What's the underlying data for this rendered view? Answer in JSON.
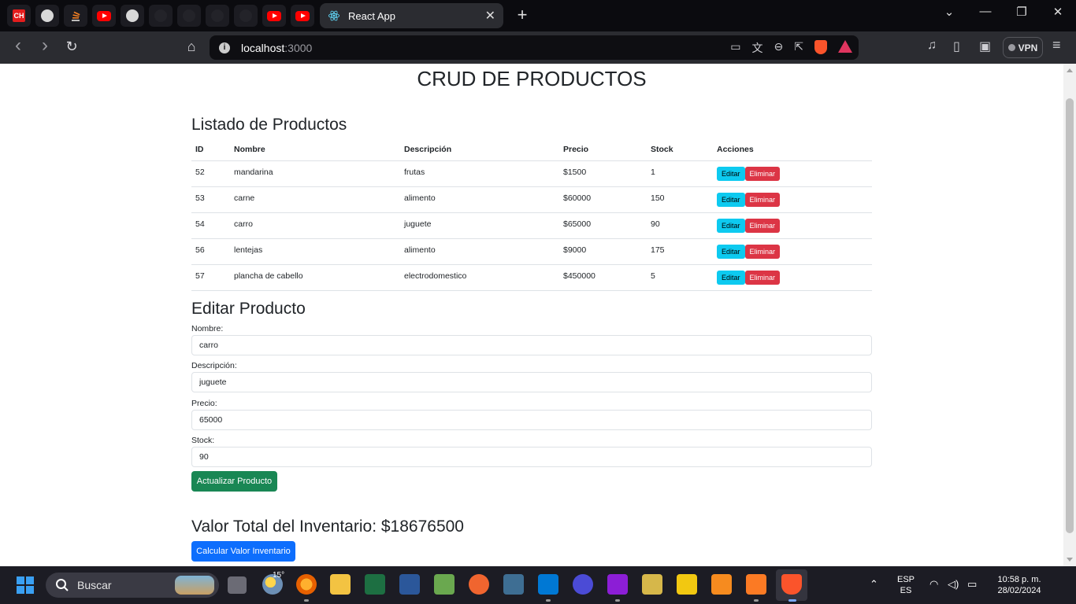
{
  "browser": {
    "pinned_tab_ch_label": "CH",
    "active_tab_title": "React App",
    "close_glyph": "✕",
    "new_tab_glyph": "+",
    "url_host": "localhost",
    "url_port": ":3000",
    "vpn_label": "VPN",
    "back_glyph": "‹",
    "forward_glyph": "›",
    "reload_glyph": "↻",
    "bookmark_glyph": "⌂",
    "minimize_glyph": "—",
    "maximize_glyph": "❐",
    "dropdown_glyph": "⌄",
    "menu_glyph": "≡"
  },
  "page": {
    "title": "CRUD DE PRODUCTOS",
    "list_heading": "Listado de Productos",
    "table": {
      "headers": [
        "ID",
        "Nombre",
        "Descripción",
        "Precio",
        "Stock",
        "Acciones"
      ],
      "rows": [
        {
          "id": "52",
          "nombre": "mandarina",
          "descripcion": "frutas",
          "precio": "$1500",
          "stock": "1"
        },
        {
          "id": "53",
          "nombre": "carne",
          "descripcion": "alimento",
          "precio": "$60000",
          "stock": "150"
        },
        {
          "id": "54",
          "nombre": "carro",
          "descripcion": "juguete",
          "precio": "$65000",
          "stock": "90"
        },
        {
          "id": "56",
          "nombre": "lentejas",
          "descripcion": "alimento",
          "precio": "$9000",
          "stock": "175"
        },
        {
          "id": "57",
          "nombre": "plancha de cabello",
          "descripcion": "electrodomestico",
          "precio": "$450000",
          "stock": "5"
        }
      ],
      "edit_label": "Editar",
      "delete_label": "Eliminar"
    },
    "edit_heading": "Editar Producto",
    "form": {
      "nombre_label": "Nombre:",
      "nombre_value": "carro",
      "descripcion_label": "Descripción:",
      "descripcion_value": "juguete",
      "precio_label": "Precio:",
      "precio_value": "65000",
      "stock_label": "Stock:",
      "stock_value": "90",
      "submit_label": "Actualizar Producto"
    },
    "total_heading": "Valor Total del Inventario: $18676500",
    "calc_label": "Calcular Valor Inventario"
  },
  "taskbar": {
    "search_label": "Buscar",
    "weather_temp": "15°",
    "language_top": "ESP",
    "language_bottom": "ES",
    "time": "10:58 p. m.",
    "date": "28/02/2024",
    "chevron_glyph": "⌃"
  },
  "colors": {
    "accent_edit": "#0dcaf0",
    "accent_delete": "#dc3545",
    "accent_update": "#198754",
    "accent_calc": "#0d6efd"
  }
}
